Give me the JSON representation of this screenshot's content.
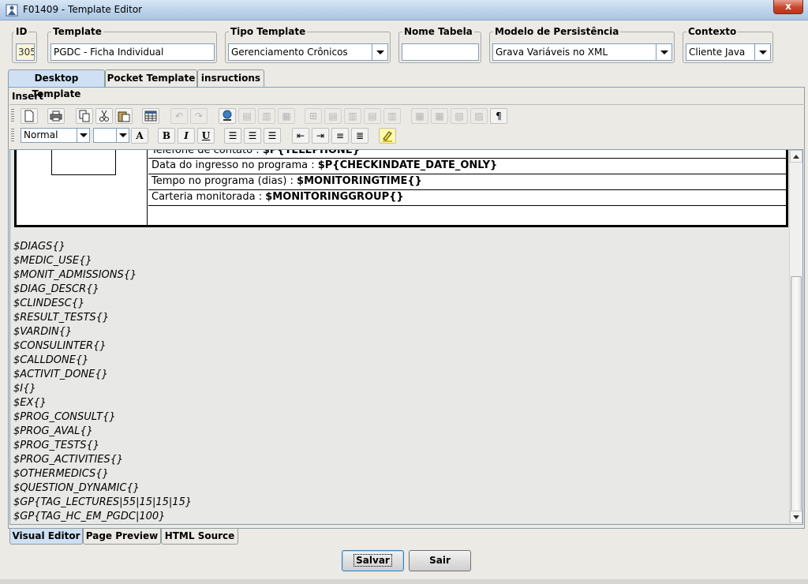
{
  "window": {
    "title": "F01409 - Template Editor",
    "close_label": "x"
  },
  "fields": {
    "id": {
      "label": "ID",
      "value": "305"
    },
    "template": {
      "label": "Template",
      "value": "PGDC - Ficha Individual"
    },
    "tipo_template": {
      "label": "Tipo Template",
      "value": "Gerenciamento Crônicos"
    },
    "nome_tabela": {
      "label": "Nome Tabela",
      "value": ""
    },
    "modelo_persistencia": {
      "label": "Modelo de Persistência",
      "value": "Grava Variáveis no XML"
    },
    "contexto": {
      "label": "Contexto",
      "value": "Cliente Java"
    }
  },
  "tabs": [
    "Desktop Template",
    "Pocket Template",
    "insructions"
  ],
  "menu": {
    "insert": "Insert"
  },
  "toolbar": {
    "style_value": "Normal",
    "size_value": "",
    "bold": "B",
    "italic": "I",
    "underline": "U",
    "paragraph": "¶",
    "font_size_icon": "A"
  },
  "doc": {
    "rows": [
      {
        "label": "Telefone de contato : ",
        "value": "$P{TELEPHONE}"
      },
      {
        "label": "Data do ingresso no programa : ",
        "value": "$P{CHECKINDATE_DATE_ONLY}"
      },
      {
        "label": "Tempo no programa (dias) : ",
        "value": "$MONITORINGTIME{}"
      },
      {
        "label": "Carteria monitorada : ",
        "value": "$MONITORINGGROUP{}"
      },
      {
        "label": "",
        "value": ""
      }
    ],
    "variables": [
      "$DIAGS{}",
      "$MEDIC_USE{}",
      "$MONIT_ADMISSIONS{}",
      "$DIAG_DESCR{}",
      "$CLINDESC{}",
      "$RESULT_TESTS{}",
      "$VARDIN{}",
      "$CONSULINTER{}",
      "$CALLDONE{}",
      "$ACTIVIT_DONE{}",
      "$I{}",
      "$EX{}",
      "$PROG_CONSULT{}",
      "$PROG_AVAL{}",
      "$PROG_TESTS{}",
      "$PROG_ACTIVITIES{}",
      "$OTHERMEDICS{}",
      "$QUESTION_DYNAMIC{}",
      "$GP{TAG_LECTURES|55|15|15|15}",
      "$GP{TAG_HC_EM_PGDC|100}"
    ]
  },
  "bottom_tabs": [
    "Visual Editor",
    "Page Preview",
    "HTML Source"
  ],
  "buttons": {
    "save": "Salvar",
    "exit": "Sair"
  }
}
